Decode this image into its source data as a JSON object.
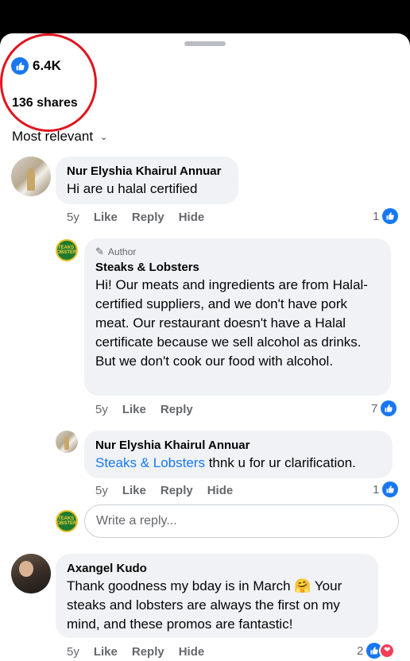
{
  "summary": {
    "reaction_count": "6.4K",
    "shares": "136 shares",
    "sort_label": "Most relevant"
  },
  "comments": [
    {
      "author": "Nur Elyshia Khairul Annuar",
      "text": "Hi are u halal certified",
      "time": "5y",
      "like_label": "Like",
      "reply_label": "Reply",
      "hide_label": "Hide",
      "reaction_count": "1"
    },
    {
      "author_tag": "Author",
      "author": "Steaks & Lobsters",
      "text": "Hi! Our meats and ingredients are from Halal-certified suppliers, and we don't have pork meat. Our restaurant doesn't have a Halal certificate because we sell alcohol as drinks. But we don't cook our food with alcohol.",
      "time": "5y",
      "like_label": "Like",
      "reply_label": "Reply",
      "reaction_count": "7"
    },
    {
      "author": "Nur Elyshia Khairul Annuar",
      "mention": "Steaks & Lobsters",
      "text": " thnk u for ur clarification.",
      "time": "5y",
      "like_label": "Like",
      "reply_label": "Reply",
      "hide_label": "Hide",
      "reaction_count": "1"
    },
    {
      "author": "Axangel Kudo",
      "text": "Thank goodness my bday is in March 🤗 Your steaks and lobsters are always the first on my mind, and these promos are fantastic!",
      "time": "5y",
      "like_label": "Like",
      "reply_label": "Reply",
      "hide_label": "Hide",
      "reaction_count": "2"
    }
  ],
  "reply_input": {
    "placeholder": "Write a reply..."
  },
  "avatar_text": {
    "steak_logo": "STEAKS & LOBSTERS"
  },
  "colors": {
    "brand_blue": "#1877f2",
    "bubble_bg": "#f0f2f5",
    "annotation_red": "#e0141e",
    "love_red": "#f33e58"
  }
}
